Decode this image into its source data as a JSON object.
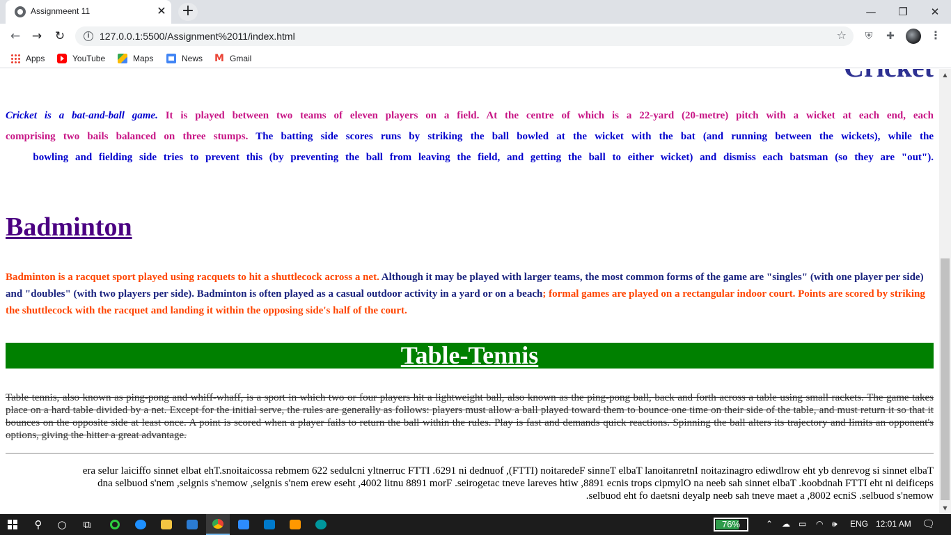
{
  "browser": {
    "tab_title": "Assignmeent 11",
    "tab_close": "✕",
    "new_tab": "+",
    "window_controls": {
      "minimize": "—",
      "restore": "❐",
      "close": "✕"
    },
    "nav": {
      "back": "←",
      "forward": "→",
      "reload": "↻"
    },
    "url": "127.0.0.1:5500/Assignment%2011/index.html",
    "star": "☆",
    "menu": "⋮",
    "bookmarks": [
      {
        "label": "Apps",
        "icon": "apps-grid-icon"
      },
      {
        "label": "YouTube",
        "icon": "youtube-icon"
      },
      {
        "label": "Maps",
        "icon": "maps-icon"
      },
      {
        "label": "News",
        "icon": "news-icon"
      },
      {
        "label": "Gmail",
        "icon": "gmail-icon"
      }
    ]
  },
  "page": {
    "cricket": {
      "heading": "Cricket",
      "intro": "Cricket is a bat-and-ball game.",
      "pink": "It is played between two teams of eleven players on a field. At the centre of which is a 22-yard (20-metre) pitch with a wicket at each end, each comprising two bails balanced on three stumps.",
      "blue": "The batting side scores runs by striking the ball bowled at the wicket with the bat (and running between the wickets), while the bowling and fielding side tries to prevent this (by preventing the ball from leaving the field, and getting the ball to either wicket) and dismiss each batsman (so they are \"out\")."
    },
    "badminton": {
      "heading": "Badminton",
      "orange_1": "Badminton is a racquet sport played using racquets to hit a shuttlecock across a net.",
      "navy": "Although it may be played with larger teams, the most common forms of the game are \"singles\" (with one player per side) and \"doubles\" (with two players per side). Badminton is often played as a casual outdoor activity in a yard or on a beach",
      "orange_2": "; formal games are played on a rectangular indoor court. Points are scored by striking the shuttlecock with the racquet and landing it within the opposing side's half of the court."
    },
    "table_tennis": {
      "heading": "Table-Tennis",
      "paragraph": "Table tennis, also known as ping-pong and whiff-whaff, is a sport in which two or four players hit a lightweight ball, also known as the ping-pong ball, back and forth across a table using small rackets. The game takes place on a hard table divided by a net. Except for the initial serve, the rules are generally as follows: players must allow a ball played toward them to bounce one time on their side of the table, and must return it so that it bounces on the opposite side at least once. A point is scored when a player fails to return the ball within the rules. Play is fast and demands quick reactions. Spinning the ball alters its trajectory and limits an opponent's options, giving the hitter a great advantage.",
      "reversed_lines": [
        "era selur laiciffo sinnet elbat ehT.snoitaicossa rebmem 622 sedulcni yltnerruc FTTI .6291 ni dednuof ,(FTTI) noitaredeF sinneT elbaT lanoitanretnI noitazinagro ediwdlrow eht yb denrevog si sinnet elbaT",
        "dna selbuod s'nem ,selgnis s'nemow ,selgnis s'nem erew eseht ,4002 litnu 8891 morF .seirogetac tneve lareves htiw ,8891 ecnis trops cipmylO na neeb sah sinnet elbaT .koobdnah FTTI eht ni deificeps",
        ".selbuod eht fo daetsni deyalp neeb sah tneve maet a ,8002 ecniS .selbuod s'nemow"
      ]
    }
  },
  "taskbar": {
    "battery_percent": 76,
    "battery_label": "76%",
    "language": "ENG",
    "time": "12:01 AM",
    "tray_icons": [
      "chevron-up-icon",
      "cloud-icon",
      "battery-icon",
      "wifi-icon",
      "volume-icon"
    ],
    "accent": "#2e9b4a"
  }
}
